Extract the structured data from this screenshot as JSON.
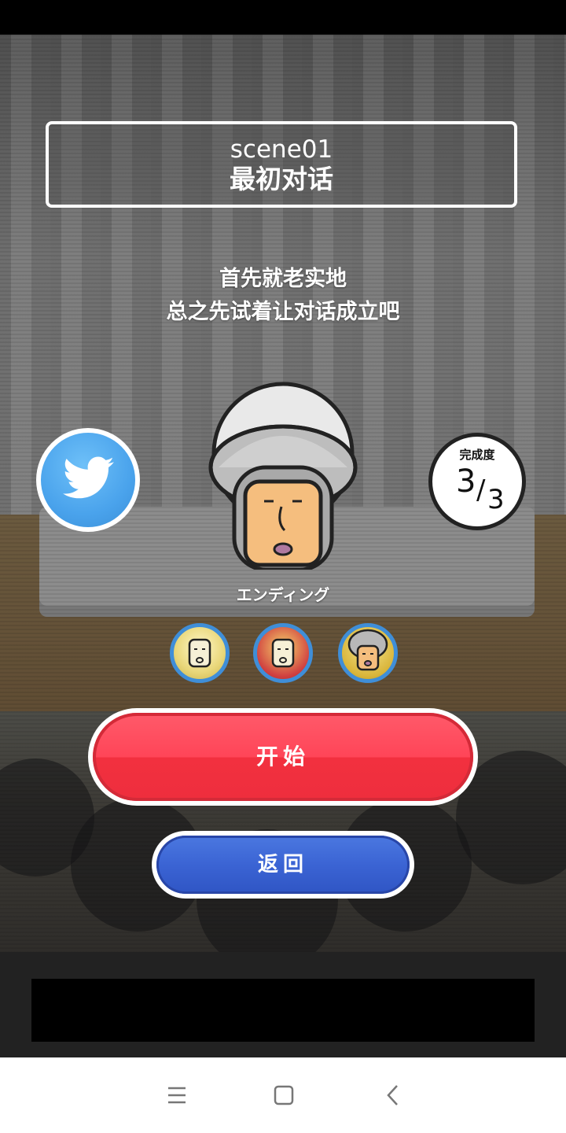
{
  "scene": {
    "id": "scene01",
    "name": "最初对话",
    "description_lines": [
      "首先就老实地",
      "总之先试着让对话成立吧"
    ]
  },
  "character": {
    "ending_label": "エンディング"
  },
  "completion": {
    "label": "完成度",
    "current": "3",
    "slash": "/",
    "total": "3"
  },
  "endings": [
    {
      "icon": "ending-portrait-yellow"
    },
    {
      "icon": "ending-portrait-red"
    },
    {
      "icon": "ending-portrait-gray"
    }
  ],
  "buttons": {
    "start_label": "开始",
    "back_label": "返回"
  },
  "share": {
    "icon": "twitter-bird-icon"
  },
  "nav": {
    "icons": [
      "menu-icon",
      "home-icon",
      "back-icon"
    ]
  },
  "colors": {
    "start_button": "#ff4558",
    "back_button": "#3b64d4",
    "twitter_blue": "#4aa3ec",
    "thumb_ring": "#3f8ed8"
  }
}
